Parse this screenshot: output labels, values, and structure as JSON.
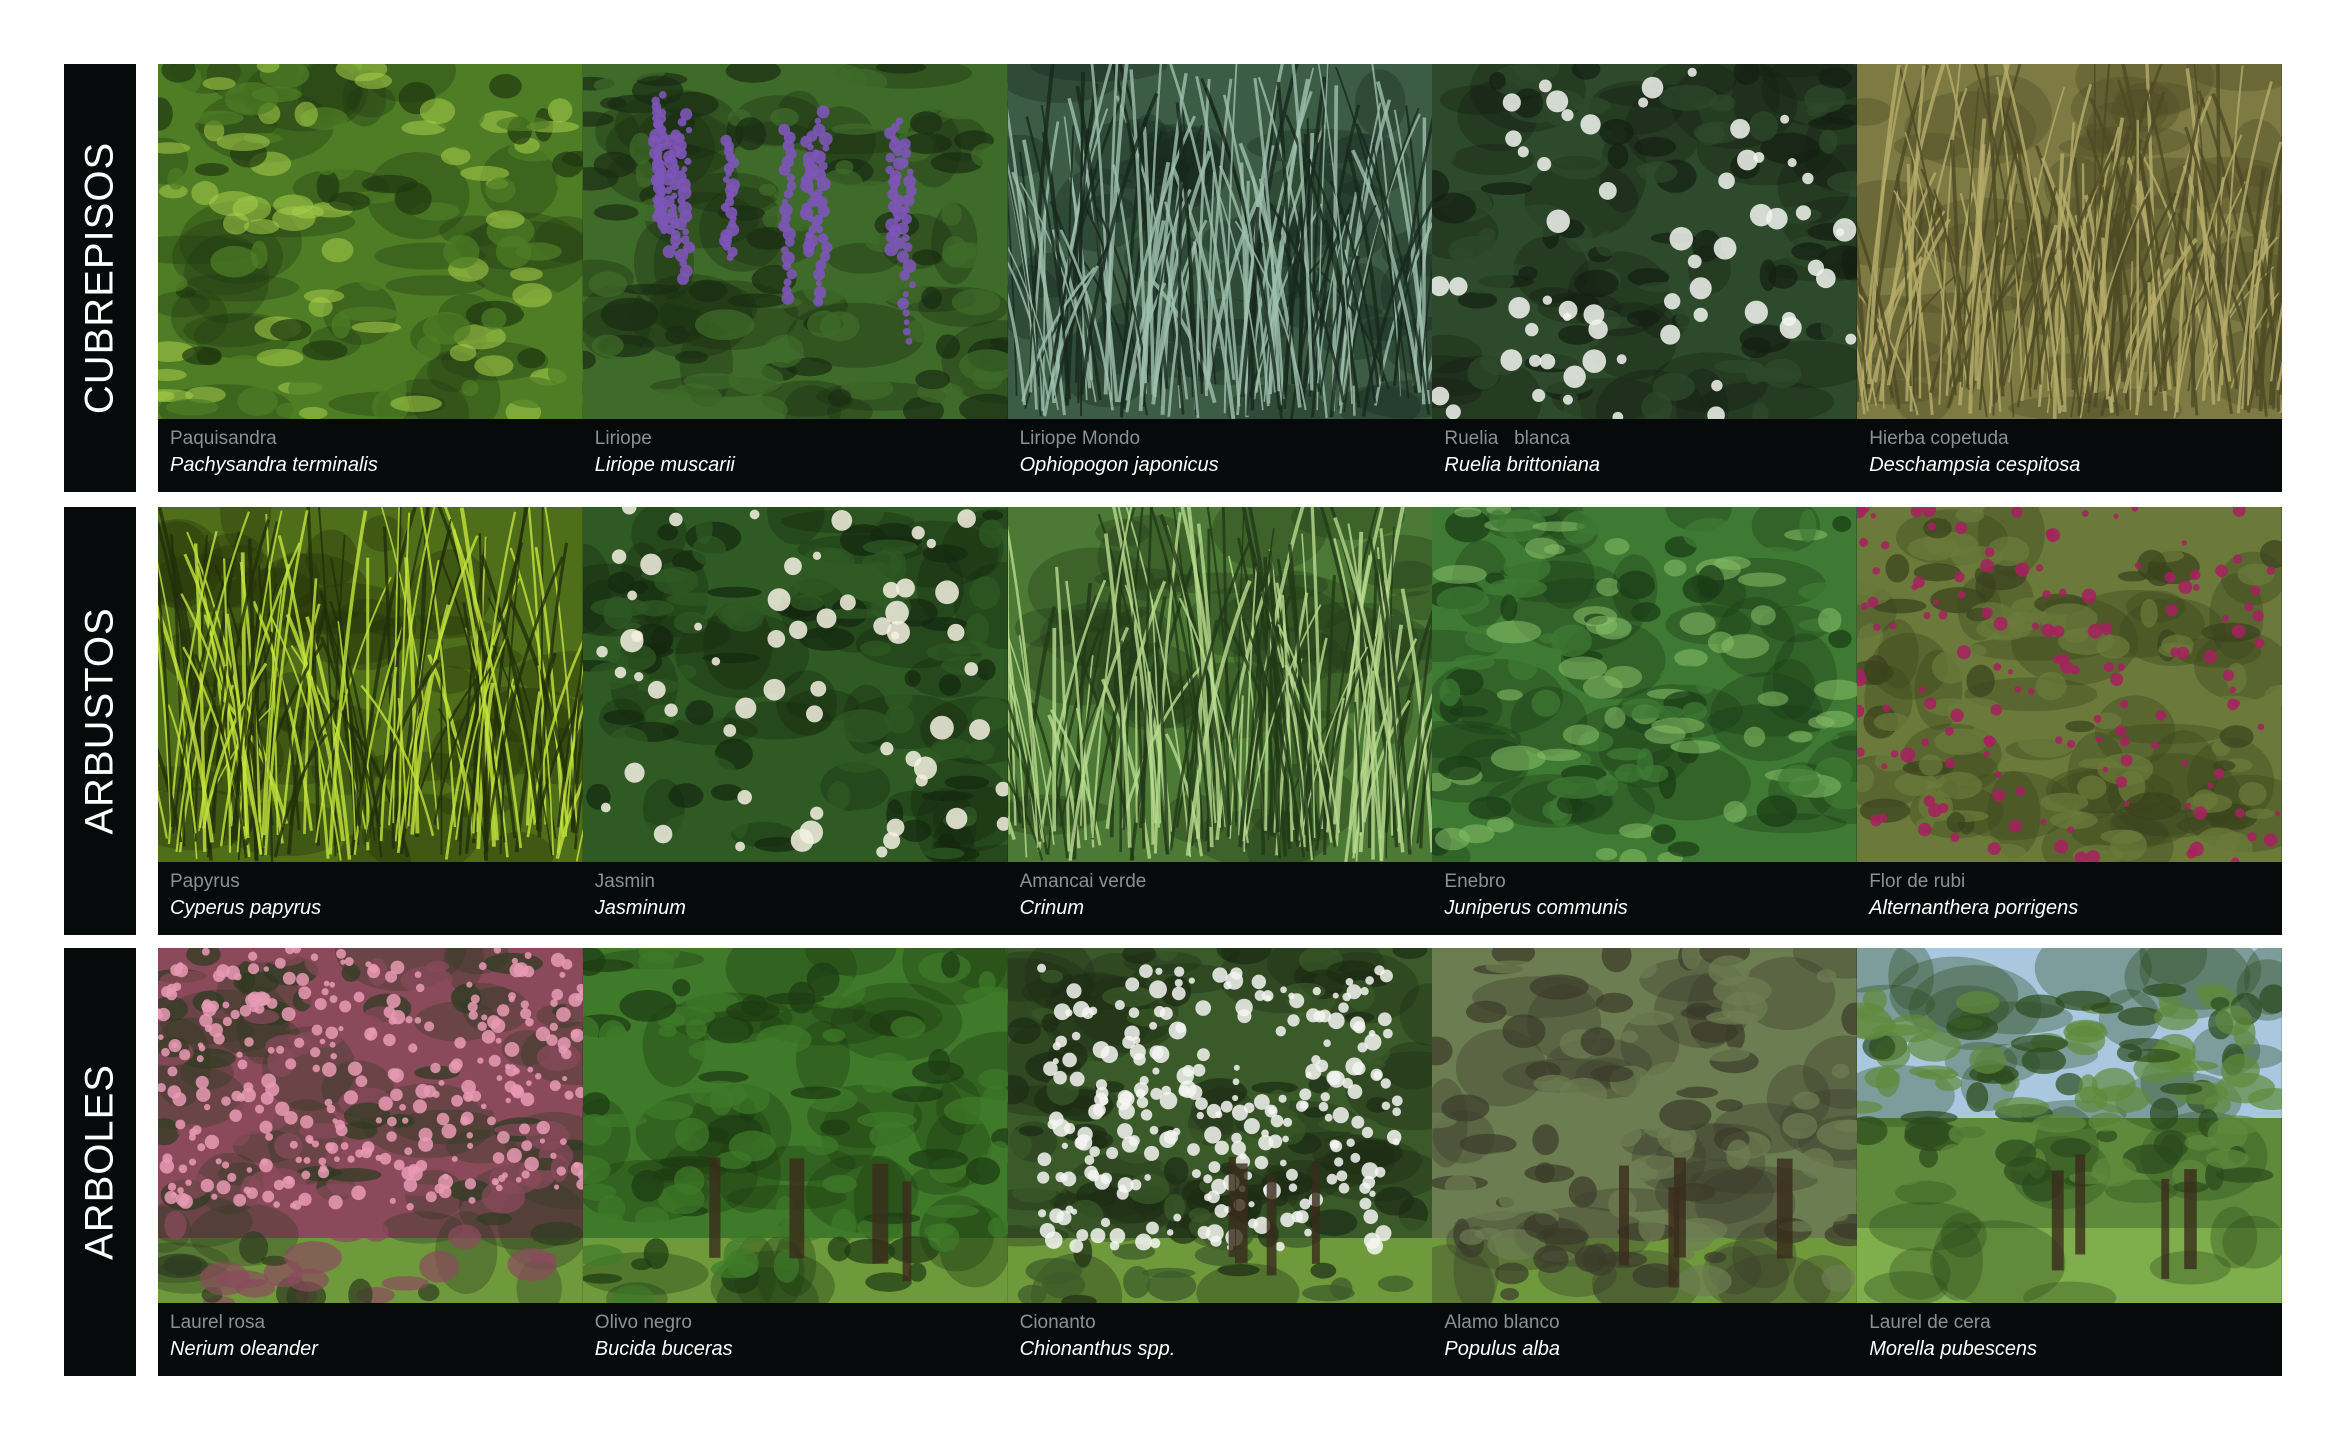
{
  "rows": [
    {
      "label": "CUBREPISOS",
      "plants": [
        {
          "common": "Paquisandra",
          "scientific": "Pachysandra terminalis",
          "photo": {
            "base": "#4f7d25",
            "accent": "#a8cf4a",
            "dark": "#1f3810",
            "style": "broad-leaves"
          }
        },
        {
          "common": "Liriope",
          "scientific": "Liriope muscarii",
          "photo": {
            "base": "#3f6b2a",
            "accent": "#7d55b8",
            "dark": "#1a2c12",
            "style": "purple-spikes"
          }
        },
        {
          "common": "Liriope Mondo",
          "scientific": "Ophiopogon japonicus",
          "photo": {
            "base": "#3c5c46",
            "accent": "#9fbfae",
            "dark": "#18281e",
            "style": "grass"
          }
        },
        {
          "common": "Ruelia   blanca",
          "scientific": "Ruelia brittoniana",
          "photo": {
            "base": "#2e4a2c",
            "accent": "#f2f4f0",
            "dark": "#141f12",
            "style": "white-dots"
          }
        },
        {
          "common": "Hierba copetuda",
          "scientific": "Deschampsia cespitosa",
          "photo": {
            "base": "#7d7a44",
            "accent": "#b6ac6a",
            "dark": "#4d4a24",
            "style": "grass"
          }
        }
      ]
    },
    {
      "label": "ARBUSTOS",
      "plants": [
        {
          "common": "Papyrus",
          "scientific": "Cyperus papyrus",
          "photo": {
            "base": "#4f6e1a",
            "accent": "#c6e33c",
            "dark": "#22300a",
            "style": "papyrus"
          }
        },
        {
          "common": "Jasmin",
          "scientific": "Jasminum",
          "photo": {
            "base": "#2f5a24",
            "accent": "#f4f1e2",
            "dark": "#14280f",
            "style": "white-dots"
          }
        },
        {
          "common": "Amancai verde",
          "scientific": "Crinum",
          "photo": {
            "base": "#4c7a36",
            "accent": "#b9db8e",
            "dark": "#223a18",
            "style": "grass"
          }
        },
        {
          "common": "Enebro",
          "scientific": "Juniperus communis",
          "photo": {
            "base": "#3f7a34",
            "accent": "#86bf67",
            "dark": "#1a3a16",
            "style": "broad-leaves"
          }
        },
        {
          "common": "Flor de rubi",
          "scientific": "Alternanthera porrigens",
          "photo": {
            "base": "#6b7a3a",
            "accent": "#a8205f",
            "dark": "#3a421c",
            "style": "magenta-dots"
          }
        }
      ]
    },
    {
      "label": "ARBOLES",
      "plants": [
        {
          "common": "Laurel rosa",
          "scientific": "Nerium oleander",
          "photo": {
            "base": "#8a4a5c",
            "accent": "#e89ab4",
            "dark": "#2e3a20",
            "style": "pink-tree"
          }
        },
        {
          "common": "Olivo negro",
          "scientific": "Bucida buceras",
          "photo": {
            "base": "#3f7a2a",
            "accent": "#8cc24e",
            "dark": "#1d3a12",
            "style": "tree"
          }
        },
        {
          "common": "Cionanto",
          "scientific": "Chionanthus spp.",
          "photo": {
            "base": "#3b5a2a",
            "accent": "#f5f6f2",
            "dark": "#1c2c14",
            "style": "white-tree"
          }
        },
        {
          "common": "Alamo blanco",
          "scientific": "Populus alba",
          "photo": {
            "base": "#6d7d52",
            "accent": "#a8b58a",
            "dark": "#3a3a2a",
            "style": "park"
          }
        },
        {
          "common": "Laurel de cera",
          "scientific": "Morella pubescens",
          "photo": {
            "base": "#5f8a3c",
            "accent": "#a9c8e0",
            "dark": "#2b4a1c",
            "style": "sky-tree"
          }
        }
      ]
    }
  ]
}
